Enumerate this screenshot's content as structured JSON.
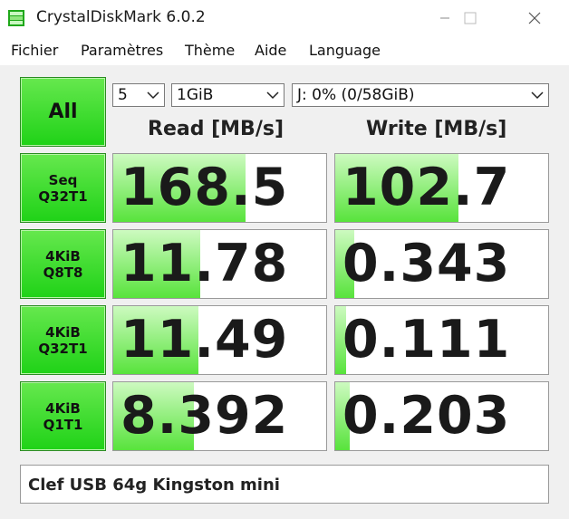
{
  "window": {
    "title": "CrystalDiskMark 6.0.2"
  },
  "menu": [
    "Fichier",
    "Paramètres",
    "Thème",
    "Aide",
    "Language"
  ],
  "controls": {
    "all_label": "All",
    "count": "5",
    "size": "1GiB",
    "drive": "J: 0% (0/58GiB)"
  },
  "headers": {
    "read": "Read [MB/s]",
    "write": "Write [MB/s]"
  },
  "tests": [
    {
      "line1": "Seq",
      "line2": "Q32T1",
      "read": "168.5",
      "write": "102.7",
      "read_fill": 0.62,
      "write_fill": 0.58
    },
    {
      "line1": "4KiB",
      "line2": "Q8T8",
      "read": "11.78",
      "write": "0.343",
      "read_fill": 0.41,
      "write_fill": 0.09
    },
    {
      "line1": "4KiB",
      "line2": "Q32T1",
      "read": "11.49",
      "write": "0.111",
      "read_fill": 0.4,
      "write_fill": 0.05
    },
    {
      "line1": "4KiB",
      "line2": "Q1T1",
      "read": "8.392",
      "write": "0.203",
      "read_fill": 0.38,
      "write_fill": 0.07
    }
  ],
  "comment": "Clef USB 64g Kingston mini",
  "colors": {
    "button_green": "#1fd217",
    "bar_green": "#58e33c"
  }
}
